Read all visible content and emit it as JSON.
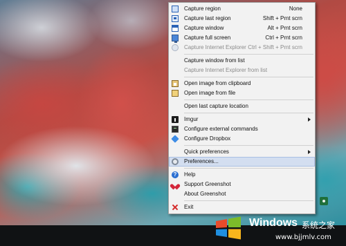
{
  "menu": {
    "items": [
      {
        "label": "Capture region",
        "shortcut": "None",
        "icon": "capture-region-icon"
      },
      {
        "label": "Capture last region",
        "shortcut": "Shift + Prnt scrn",
        "icon": "capture-last-region-icon"
      },
      {
        "label": "Capture window",
        "shortcut": "Alt + Prnt scrn",
        "icon": "capture-window-icon"
      },
      {
        "label": "Capture full screen",
        "shortcut": "Ctrl + Prnt scrn",
        "icon": "monitor-icon"
      },
      {
        "label": "Capture Internet Explorer",
        "shortcut": "Ctrl + Shift + Prnt scrn",
        "icon": "internet-explorer-icon",
        "disabled": true
      },
      {
        "label": "Capture window from list"
      },
      {
        "label": "Capture Internet Explorer from list",
        "disabled": true
      },
      {
        "label": "Open image from clipboard",
        "icon": "clipboard-icon"
      },
      {
        "label": "Open image from file",
        "icon": "open-file-icon"
      },
      {
        "label": "Open last capture location"
      },
      {
        "label": "Imgur",
        "icon": "imgur-icon",
        "submenu": true
      },
      {
        "label": "Configure external commands",
        "icon": "external-command-icon"
      },
      {
        "label": "Configure Dropbox",
        "icon": "dropbox-icon"
      },
      {
        "label": "Quick preferences",
        "submenu": true
      },
      {
        "label": "Preferences...",
        "icon": "gear-icon",
        "highlighted": true
      },
      {
        "label": "Help",
        "icon": "help-icon"
      },
      {
        "label": "Support Greenshot",
        "icon": "heart-icon"
      },
      {
        "label": "About Greenshot"
      },
      {
        "label": "Exit",
        "icon": "close-icon"
      }
    ]
  },
  "watermark": {
    "brand": "Windows",
    "brand_suffix": "系统之家",
    "url": "www.bjjmlv.com"
  },
  "colors": {
    "menu_background": "#f2f2f2",
    "highlight": "#d3def0",
    "disabled_text": "#8a8a8a",
    "taskbar": "#101214"
  }
}
